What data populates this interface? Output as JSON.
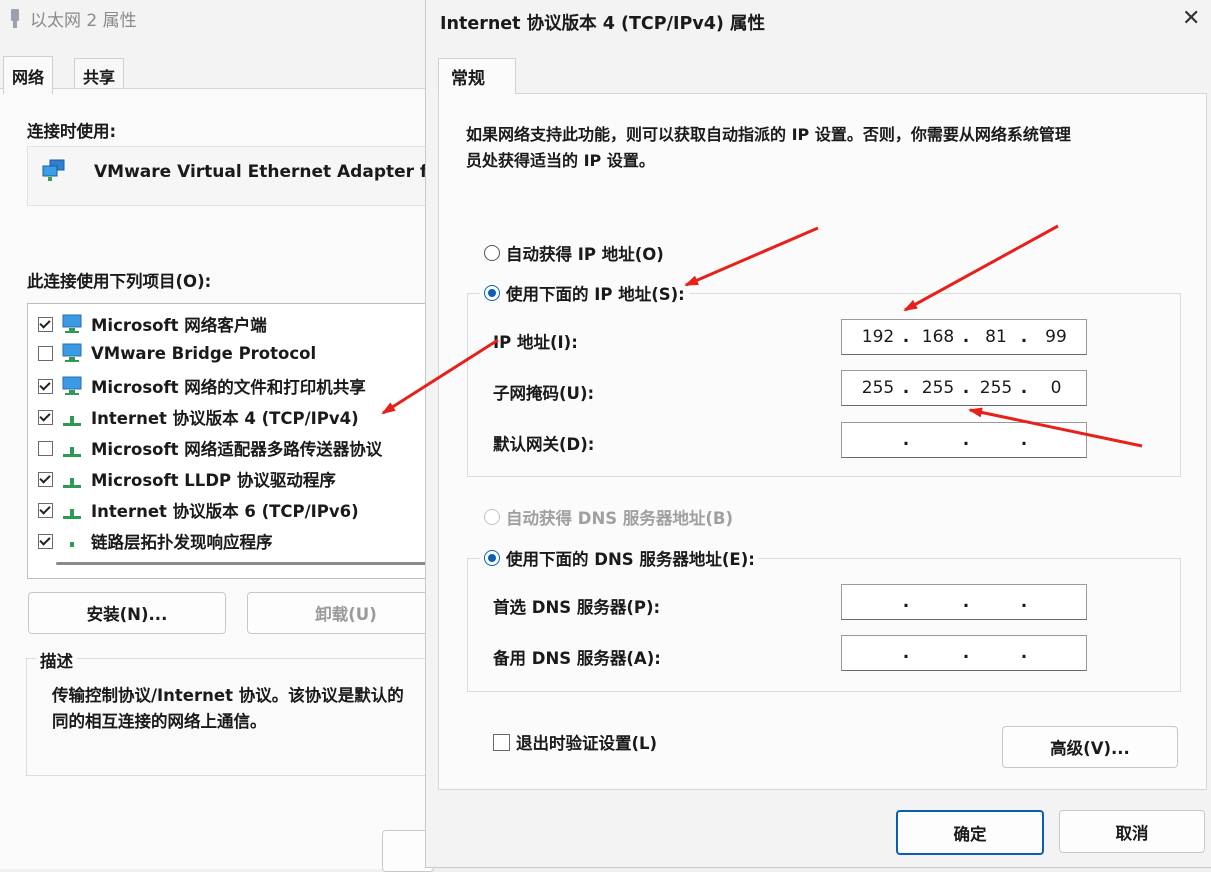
{
  "back_window": {
    "title": "以太网 2 属性",
    "tabs": [
      "网络",
      "共享"
    ],
    "connect_using_label": "连接时使用:",
    "adapter_name": "VMware Virtual Ethernet Adapter fo",
    "items_label": "此连接使用下列项目(O):",
    "items": [
      {
        "label": "Microsoft 网络客户端",
        "checked": true,
        "icon": "network-client-icon"
      },
      {
        "label": "VMware Bridge Protocol",
        "checked": false,
        "icon": "network-client-icon"
      },
      {
        "label": "Microsoft 网络的文件和打印机共享",
        "checked": true,
        "icon": "network-client-icon"
      },
      {
        "label": "Internet 协议版本 4 (TCP/IPv4)",
        "checked": true,
        "icon": "protocol-icon"
      },
      {
        "label": "Microsoft 网络适配器多路传送器协议",
        "checked": false,
        "icon": "protocol-icon"
      },
      {
        "label": "Microsoft LLDP 协议驱动程序",
        "checked": true,
        "icon": "protocol-icon"
      },
      {
        "label": "Internet 协议版本 6 (TCP/IPv6)",
        "checked": true,
        "icon": "protocol-icon"
      },
      {
        "label": "链路层拓扑发现响应程序",
        "checked": true,
        "icon": "protocol-icon"
      }
    ],
    "install_button": "安装(N)...",
    "uninstall_button": "卸载(U)",
    "description_label": "描述",
    "description_line1": "传输控制协议/Internet 协议。该协议是默认的",
    "description_line2": "同的相互连接的网络上通信。"
  },
  "dialog": {
    "title": "Internet 协议版本 4 (TCP/IPv4) 属性",
    "close_glyph": "✕",
    "tab": "常规",
    "intro_line1": "如果网络支持此功能，则可以获取自动指派的 IP 设置。否则，你需要从网络系统管理",
    "intro_line2": "员处获得适当的 IP 设置。",
    "auto_ip_label": "自动获得 IP 地址(O)",
    "manual_ip_label": "使用下面的 IP 地址(S):",
    "ip_label": "IP 地址(I):",
    "subnet_label": "子网掩码(U):",
    "gateway_label": "默认网关(D):",
    "ip_address": [
      "192",
      "168",
      "81",
      "99"
    ],
    "subnet_mask": [
      "255",
      "255",
      "255",
      "0"
    ],
    "gateway": [
      "",
      "",
      "",
      ""
    ],
    "auto_dns_label": "自动获得 DNS 服务器地址(B)",
    "manual_dns_label": "使用下面的 DNS 服务器地址(E):",
    "preferred_dns_label": "首选 DNS 服务器(P):",
    "alternate_dns_label": "备用 DNS 服务器(A):",
    "preferred_dns": [
      "",
      "",
      "",
      ""
    ],
    "alternate_dns": [
      "",
      "",
      "",
      ""
    ],
    "validate_label": "退出时验证设置(L)",
    "validate_checked": false,
    "advanced_button": "高级(V)...",
    "ok_button": "确定",
    "cancel_button": "取消"
  },
  "colors": {
    "accent": "#0a5fb4",
    "annotation_arrow": "#e8201b"
  }
}
